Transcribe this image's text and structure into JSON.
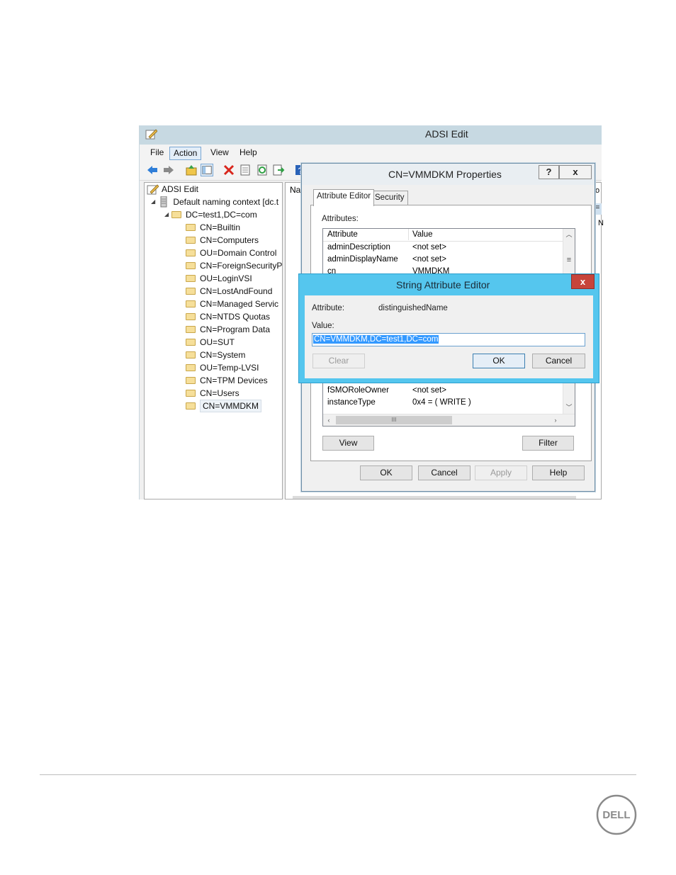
{
  "adsi": {
    "title": "ADSI Edit",
    "menu": [
      "File",
      "Action",
      "View",
      "Help"
    ],
    "toolbar_icons": [
      "back-arrow-icon",
      "forward-arrow-icon",
      "up-folder-icon",
      "show-hide-tree-icon",
      "delete-icon",
      "properties-icon",
      "refresh-icon",
      "export-list-icon",
      "help-icon"
    ],
    "tree": {
      "root": "ADSI Edit",
      "context": "Default naming context [dc.t",
      "domain": "DC=test1,DC=com",
      "children": [
        "CN=Builtin",
        "CN=Computers",
        "OU=Domain Control",
        "CN=ForeignSecurityP",
        "OU=LoginVSI",
        "CN=LostAndFound",
        "CN=Managed Servic",
        "CN=NTDS Quotas",
        "CN=Program Data",
        "OU=SUT",
        "CN=System",
        "OU=Temp-LVSI",
        "CN=TPM Devices",
        "CN=Users",
        "CN=VMMDKM"
      ],
      "selected": "CN=VMMDKM"
    },
    "name_column_header": "Na",
    "right_edge_glyphs": [
      "o",
      "=",
      "N"
    ]
  },
  "properties": {
    "title": "CN=VMMDKM Properties",
    "help_button": "?",
    "close_button": "x",
    "tabs": [
      "Attribute Editor",
      "Security"
    ],
    "attributes_label": "Attributes:",
    "columns": [
      "Attribute",
      "Value"
    ],
    "rows_top": [
      {
        "attr": "adminDescription",
        "value": "<not set>"
      },
      {
        "attr": "adminDisplayName",
        "value": "<not set>"
      },
      {
        "attr": "cn",
        "value": "VMMDKM"
      }
    ],
    "rows_bottom": [
      {
        "attr": "fSMORoleOwner",
        "value": "<not set>"
      },
      {
        "attr": "instanceType",
        "value": "0x4 = ( WRITE )"
      }
    ],
    "view_button": "View",
    "filter_button": "Filter",
    "ok_button": "OK",
    "cancel_button": "Cancel",
    "apply_button": "Apply",
    "help_label": "Help"
  },
  "string_editor": {
    "title": "String Attribute Editor",
    "close_button": "x",
    "attribute_label": "Attribute:",
    "attribute_name": "distinguishedName",
    "value_label": "Value:",
    "value": "CN=VMMDKM,DC=test1,DC=com",
    "clear_button": "Clear",
    "ok_button": "OK",
    "cancel_button": "Cancel"
  },
  "footer": {
    "logo_text": "DELL"
  },
  "colors": {
    "dialog_accent": "#55c6ee",
    "close_red": "#c7443a",
    "selection_blue": "#3399ff"
  }
}
